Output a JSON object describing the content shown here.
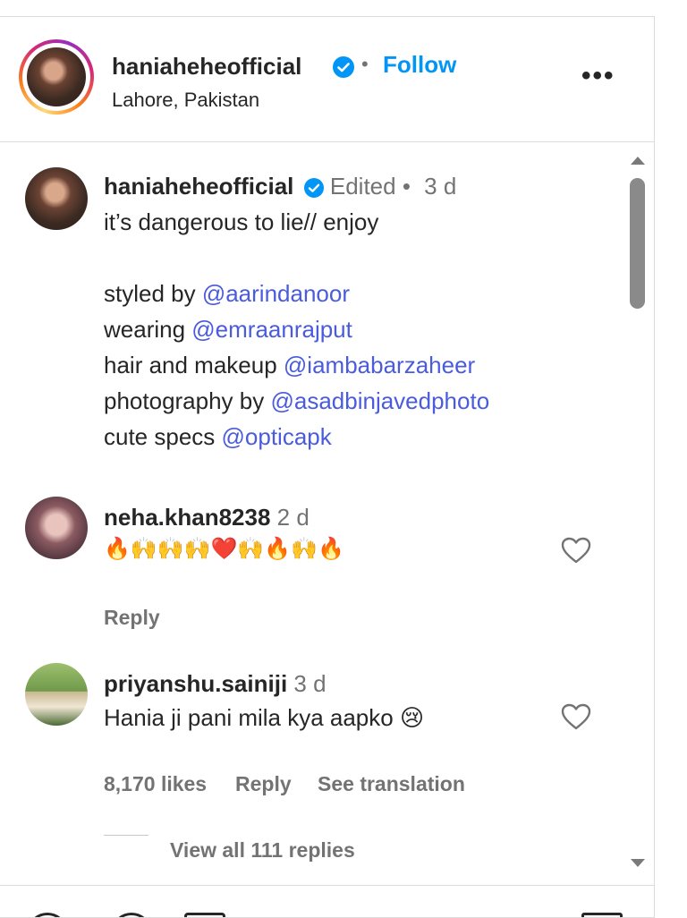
{
  "header": {
    "username": "haniaheheofficial",
    "dot": "•",
    "follow_label": "Follow",
    "location": "Lahore, Pakistan",
    "more_label": "•••"
  },
  "post": {
    "username": "haniaheheofficial",
    "edited": "Edited",
    "dot": "•",
    "time": "3 d",
    "caption_line": "it’s dangerous to lie// enjoy",
    "credits": [
      {
        "prefix": "styled by ",
        "mention": "@aarindanoor"
      },
      {
        "prefix": "wearing ",
        "mention": "@emraanrajput"
      },
      {
        "prefix": "hair and makeup ",
        "mention": "@iambabarzaheer"
      },
      {
        "prefix": "photography by ",
        "mention": "@asadbinjavedphoto"
      },
      {
        "prefix": "cute specs ",
        "mention": "@opticapk"
      }
    ]
  },
  "comments": [
    {
      "username": "neha.khan8238",
      "time": "2 d",
      "text": "🔥🙌🙌🙌❤️🙌🔥🙌🔥",
      "reply_label": "Reply"
    },
    {
      "username": "priyanshu.sainiji",
      "time": "3 d",
      "text": "Hania ji pani mila kya aapko 😢",
      "likes": "8,170 likes",
      "reply_label": "Reply",
      "translation_label": "See translation",
      "view_replies": "View all 111 replies"
    }
  ],
  "colors": {
    "accent": "#0095f6",
    "mention": "#4a5cdb",
    "muted": "#737373",
    "text": "#262626"
  }
}
